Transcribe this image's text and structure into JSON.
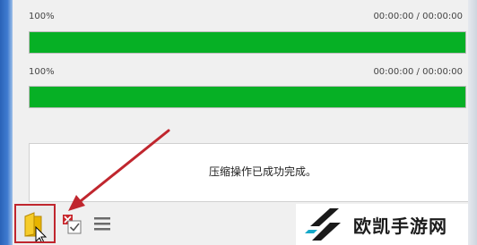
{
  "progress": [
    {
      "percent_label": "100%",
      "time_label": "00:00:00 / 00:00:00",
      "fill_fraction": 1.0
    },
    {
      "percent_label": "100%",
      "time_label": "00:00:00 / 00:00:00",
      "fill_fraction": 1.0
    }
  ],
  "message": "压缩操作已成功完成。",
  "colors": {
    "progress_fill": "#06b025",
    "highlight_box": "#c0262e",
    "arrow": "#c0262e"
  },
  "toolbar": {
    "icons": [
      "open-folder-icon",
      "close-checkbox-icon",
      "menu-icon"
    ]
  },
  "watermark": {
    "logo": "ok-logo",
    "text": "欧凯手游网"
  }
}
